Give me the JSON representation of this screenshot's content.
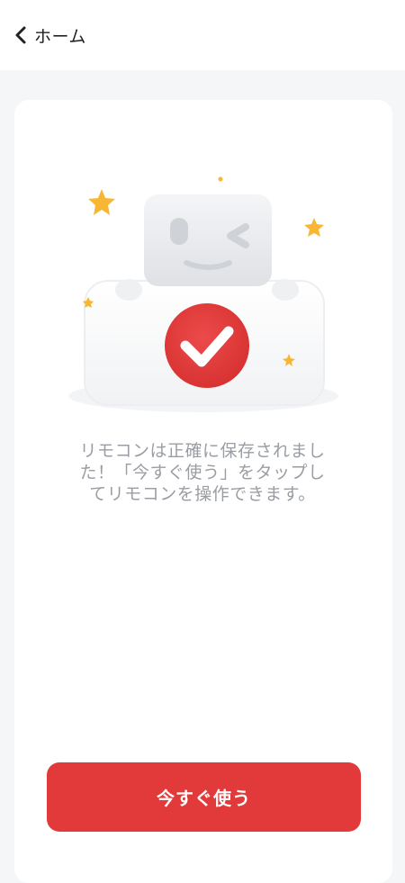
{
  "header": {
    "back_label": "ホーム"
  },
  "main": {
    "message": "リモコンは正確に保存されました！「今すぐ使う」をタップしてリモコンを操作できます。",
    "primary_button_label": "今すぐ使う"
  },
  "icons": {
    "back": "chevron-left-icon",
    "robot": "robot-illustration",
    "check": "check-circle-icon",
    "stars": "star-icon"
  },
  "colors": {
    "accent": "#e23a3a",
    "background": "#f5f6f8",
    "card": "#ffffff",
    "message_text": "#9a9ea4",
    "star": "#f7b733"
  }
}
